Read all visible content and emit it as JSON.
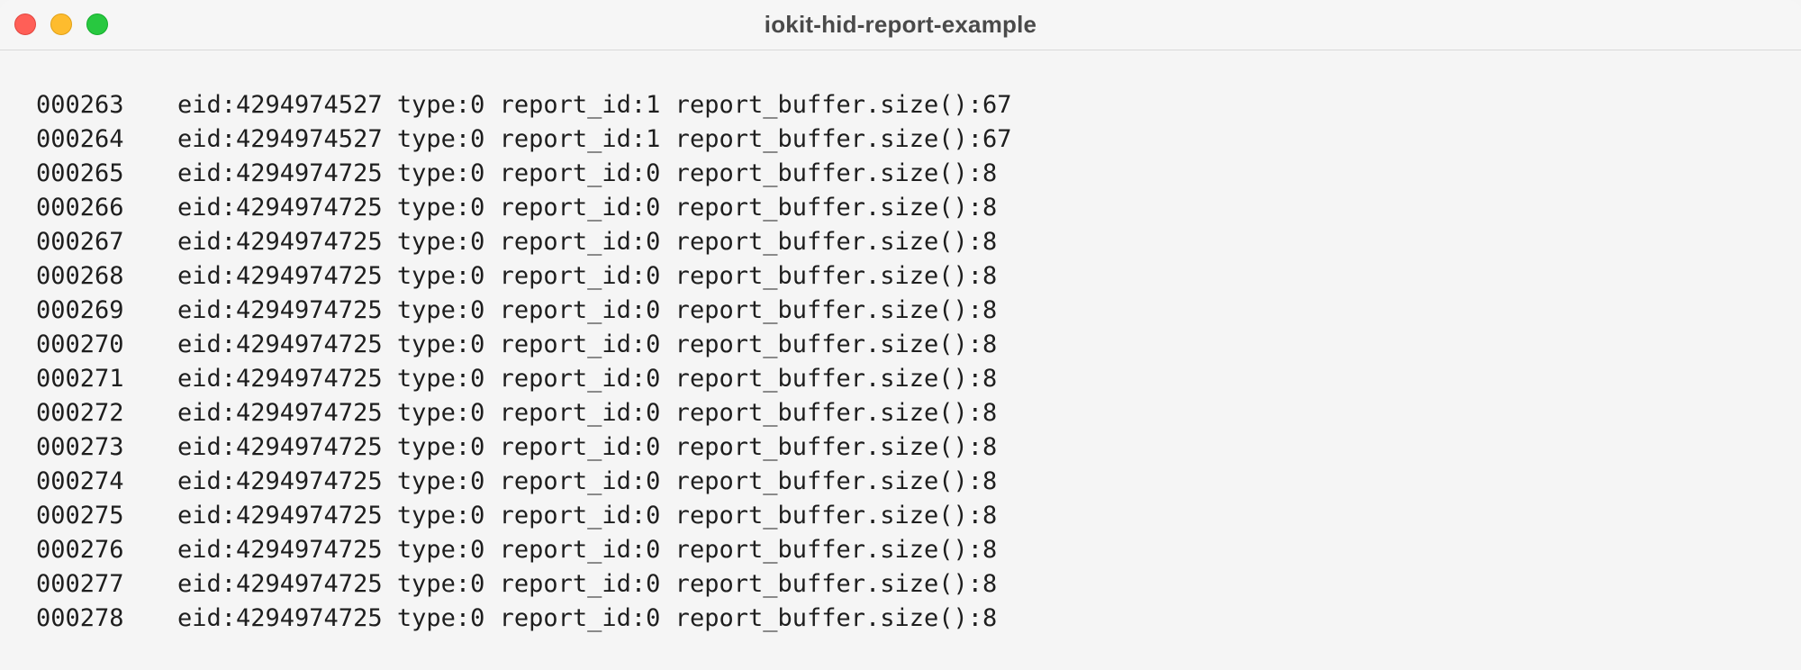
{
  "window": {
    "title": "iokit-hid-report-example"
  },
  "log": {
    "rows": [
      {
        "index": "000263",
        "message": "eid:4294974527 type:0 report_id:1 report_buffer.size():67"
      },
      {
        "index": "000264",
        "message": "eid:4294974527 type:0 report_id:1 report_buffer.size():67"
      },
      {
        "index": "000265",
        "message": "eid:4294974725 type:0 report_id:0 report_buffer.size():8"
      },
      {
        "index": "000266",
        "message": "eid:4294974725 type:0 report_id:0 report_buffer.size():8"
      },
      {
        "index": "000267",
        "message": "eid:4294974725 type:0 report_id:0 report_buffer.size():8"
      },
      {
        "index": "000268",
        "message": "eid:4294974725 type:0 report_id:0 report_buffer.size():8"
      },
      {
        "index": "000269",
        "message": "eid:4294974725 type:0 report_id:0 report_buffer.size():8"
      },
      {
        "index": "000270",
        "message": "eid:4294974725 type:0 report_id:0 report_buffer.size():8"
      },
      {
        "index": "000271",
        "message": "eid:4294974725 type:0 report_id:0 report_buffer.size():8"
      },
      {
        "index": "000272",
        "message": "eid:4294974725 type:0 report_id:0 report_buffer.size():8"
      },
      {
        "index": "000273",
        "message": "eid:4294974725 type:0 report_id:0 report_buffer.size():8"
      },
      {
        "index": "000274",
        "message": "eid:4294974725 type:0 report_id:0 report_buffer.size():8"
      },
      {
        "index": "000275",
        "message": "eid:4294974725 type:0 report_id:0 report_buffer.size():8"
      },
      {
        "index": "000276",
        "message": "eid:4294974725 type:0 report_id:0 report_buffer.size():8"
      },
      {
        "index": "000277",
        "message": "eid:4294974725 type:0 report_id:0 report_buffer.size():8"
      },
      {
        "index": "000278",
        "message": "eid:4294974725 type:0 report_id:0 report_buffer.size():8"
      }
    ]
  }
}
